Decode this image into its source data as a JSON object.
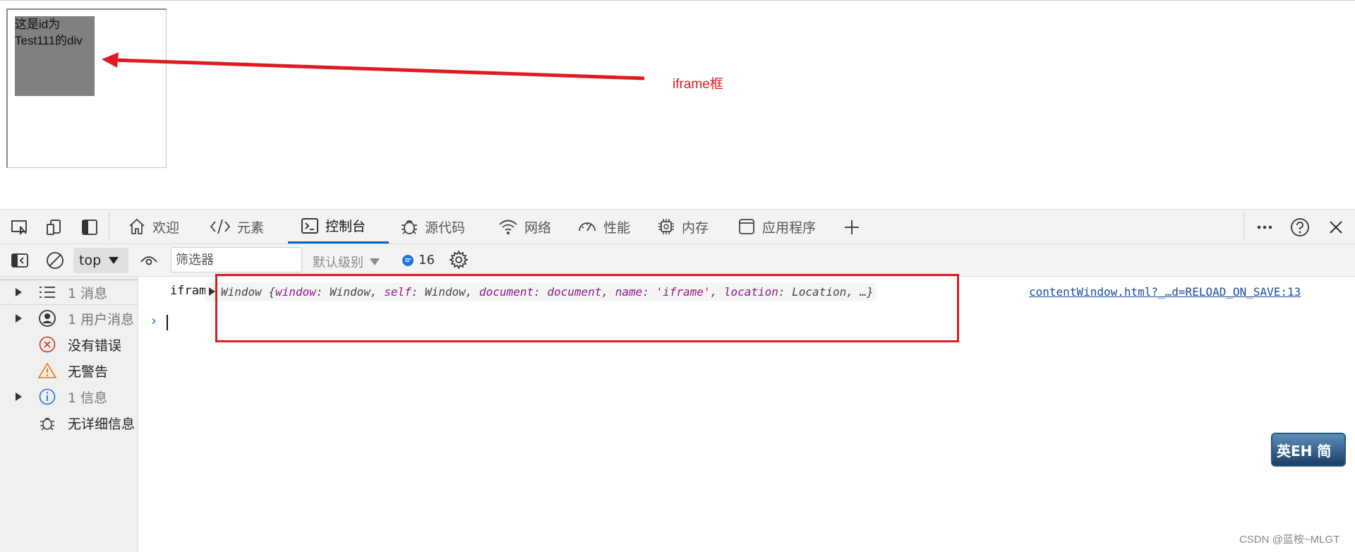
{
  "page": {
    "div_text": "这是id为Test111的div",
    "annotation": "iframe框"
  },
  "devtools": {
    "tabs": [
      {
        "label": "欢迎",
        "icon": "home-icon"
      },
      {
        "label": "元素",
        "icon": "code-icon"
      },
      {
        "label": "控制台",
        "icon": "console-icon",
        "active": true
      },
      {
        "label": "源代码",
        "icon": "bug-icon"
      },
      {
        "label": "网络",
        "icon": "wifi-icon"
      },
      {
        "label": "性能",
        "icon": "gauge-icon"
      },
      {
        "label": "内存",
        "icon": "chip-icon"
      },
      {
        "label": "应用程序",
        "icon": "app-window-icon"
      }
    ],
    "console_bar": {
      "context": "top",
      "filter_placeholder": "筛选器",
      "level": "默认级别",
      "message_count": "16"
    },
    "sidebar": [
      {
        "label": "1 消息",
        "icon": "list-icon",
        "expandable": true
      },
      {
        "label": "1 用户消息",
        "icon": "user-icon",
        "expandable": true
      },
      {
        "label": "没有错误",
        "icon": "error-icon",
        "expandable": false
      },
      {
        "label": "无警告",
        "icon": "warning-icon",
        "expandable": false
      },
      {
        "label": "1 信息",
        "icon": "info-icon",
        "expandable": true
      },
      {
        "label": "无详细信息",
        "icon": "bug-icon",
        "expandable": false
      }
    ],
    "log": {
      "source": "iframe",
      "object_prefix": "Window {",
      "props": [
        {
          "key": "window",
          "val": "Window"
        },
        {
          "key": "self",
          "val": "Window"
        },
        {
          "key": "document",
          "val": "document"
        },
        {
          "key": "name",
          "val": "'iframe'"
        },
        {
          "key": "location",
          "val": "Location"
        }
      ],
      "object_suffix": ", …}",
      "link": "contentWindow.html?_…d=RELOAD_ON_SAVE:13"
    }
  },
  "ime": "英EH 简",
  "watermark": "CSDN @蓝桉~MLGT",
  "colors": {
    "accent": "#0b63c4",
    "annotation": "#e01a22"
  }
}
